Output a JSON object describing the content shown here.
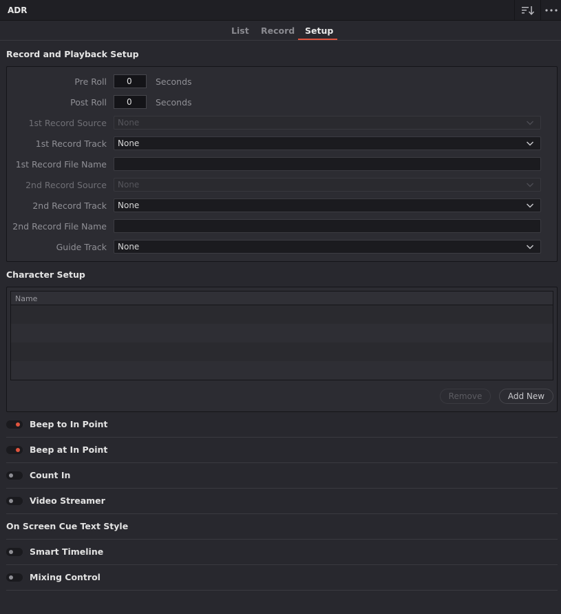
{
  "window": {
    "title": "ADR"
  },
  "tabs": [
    {
      "label": "List",
      "active": false
    },
    {
      "label": "Record",
      "active": false
    },
    {
      "label": "Setup",
      "active": true
    }
  ],
  "record_setup": {
    "title": "Record and Playback Setup",
    "pre_roll": {
      "label": "Pre Roll",
      "value": "0",
      "unit": "Seconds"
    },
    "post_roll": {
      "label": "Post Roll",
      "value": "0",
      "unit": "Seconds"
    },
    "source1": {
      "label": "1st Record Source",
      "value": "None",
      "disabled": true
    },
    "track1": {
      "label": "1st Record Track",
      "value": "None"
    },
    "file1": {
      "label": "1st Record File Name",
      "value": ""
    },
    "source2": {
      "label": "2nd Record Source",
      "value": "None",
      "disabled": true
    },
    "track2": {
      "label": "2nd Record Track",
      "value": "None"
    },
    "file2": {
      "label": "2nd Record File Name",
      "value": ""
    },
    "guide": {
      "label": "Guide Track",
      "value": "None"
    }
  },
  "character_setup": {
    "title": "Character Setup",
    "column_name": "Name",
    "rows": [],
    "remove_label": "Remove",
    "add_label": "Add New"
  },
  "toggles": {
    "beep_to": {
      "label": "Beep to In Point",
      "on": true
    },
    "beep_at": {
      "label": "Beep at In Point",
      "on": true
    },
    "count_in": {
      "label": "Count In",
      "on": false
    },
    "video_streamer": {
      "label": "Video Streamer",
      "on": false
    },
    "cue_text_style": {
      "label": "On Screen Cue Text Style"
    },
    "smart_timeline": {
      "label": "Smart Timeline",
      "on": false
    },
    "mixing_control": {
      "label": "Mixing Control",
      "on": false
    }
  },
  "colors": {
    "accent": "#e0543e",
    "background": "#28282e"
  },
  "icons": {
    "sort": "sort-descending-icon",
    "more": "more-options-icon",
    "dropdown": "chevron-down-icon"
  }
}
